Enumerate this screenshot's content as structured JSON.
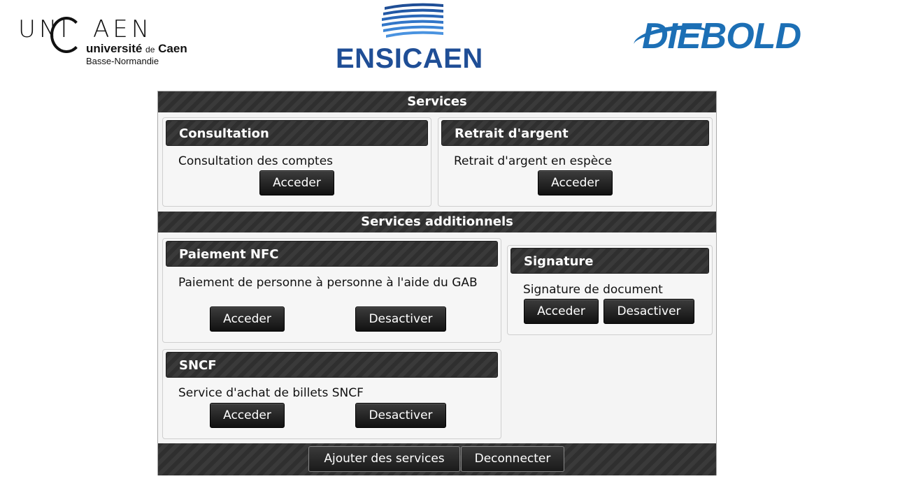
{
  "logos": {
    "unicaen": {
      "word": "UNICAEN",
      "line1": "université",
      "line1_de": "de",
      "line1_city": "Caen",
      "line2": "Basse-Normandie"
    },
    "ensicaen": {
      "word": "ENSICAEN"
    },
    "diebold": {
      "word": "DIEBOLD"
    }
  },
  "sections": {
    "services_title": "Services",
    "additional_title": "Services additionnels"
  },
  "cards": {
    "consultation": {
      "title": "Consultation",
      "desc": "Consultation des comptes",
      "access": "Acceder"
    },
    "retrait": {
      "title": "Retrait d'argent",
      "desc": "Retrait d'argent en espèce",
      "access": "Acceder"
    },
    "nfc": {
      "title": "Paiement NFC",
      "desc": "Paiement de personne à personne à l'aide du GAB",
      "access": "Acceder",
      "deactivate": "Desactiver"
    },
    "signature": {
      "title": "Signature",
      "desc": "Signature de document",
      "access": "Acceder",
      "deactivate": "Desactiver"
    },
    "sncf": {
      "title": "SNCF",
      "desc": "Service d'achat de billets SNCF",
      "access": "Acceder",
      "deactivate": "Desactiver"
    }
  },
  "footer": {
    "add_services": "Ajouter des services",
    "disconnect": "Deconnecter"
  },
  "colors": {
    "bar_dark": "#2f2f2f",
    "panel_bg": "#f4f4f4",
    "ensicaen_blue": "#1f4e96",
    "diebold_blue": "#1c6fb5"
  }
}
